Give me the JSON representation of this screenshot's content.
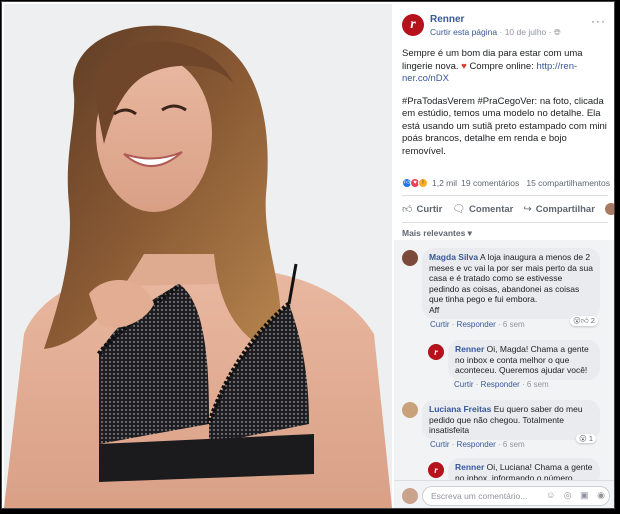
{
  "page": {
    "name": "Renner",
    "logo_letter": "r",
    "follow_label": "Curtir esta página",
    "date": "10 de julho",
    "separator": "·",
    "globe_icon": "globe-icon",
    "more_label": "···"
  },
  "post": {
    "line1": "Sempre é um bom dia para estar com uma lingerie nova.",
    "line1_cta": "Compre online:",
    "link": "http://ren-ner.co/nDX",
    "desc": "#PraTodasVerem #PraCegoVer: na foto, clicada em estúdio, temos uma modelo no detalhe. Ela está usando um sutiã preto estampado com mini poás brancos, detalhe em renda e bojo removível."
  },
  "stats": {
    "reactions": "1,2 mil",
    "comments": "19 comentários",
    "shares": "15 compartilhamentos"
  },
  "actions": {
    "like": "Curtir",
    "comment": "Comentar",
    "share": "Compartilhar",
    "share_as_caret": "▾"
  },
  "sort_label": "Mais relevantes ▾",
  "comments": [
    {
      "author": "Magda Silva",
      "text": "A loja inaugura a menos de 2 meses e vc vai la por ser mais perto da sua casa e é tratado como se estivesse pedindo as coisas, abandonei as coisas que tinha pego e fui embora.",
      "extra": "Aff",
      "like": "Curtir",
      "reply": "Responder",
      "time": "6 sem",
      "reaction_count": "2"
    },
    {
      "author": "Renner",
      "text": "Oi, Magda! Chama a gente no inbox e conta melhor o que aconteceu. Queremos ajudar você!",
      "like": "Curtir",
      "reply": "Responder",
      "time": "6 sem"
    },
    {
      "author": "Luciana Freitas",
      "text": "Eu quero saber do meu pedido que não chegou. Totalmente insatisfeita",
      "like": "Curtir",
      "reply": "Responder",
      "time": "6 sem",
      "reaction_count": "1"
    },
    {
      "author": "Renner",
      "text": "Oi, Luciana! Chama a gente no inbox, informando o número"
    }
  ],
  "composer": {
    "placeholder": "Escreva um comentário...",
    "tools": "☺ ◎ ▣ ◉"
  },
  "colors": {
    "brand": "#b5121b",
    "link": "#385898",
    "bubble": "#e9ebee"
  }
}
